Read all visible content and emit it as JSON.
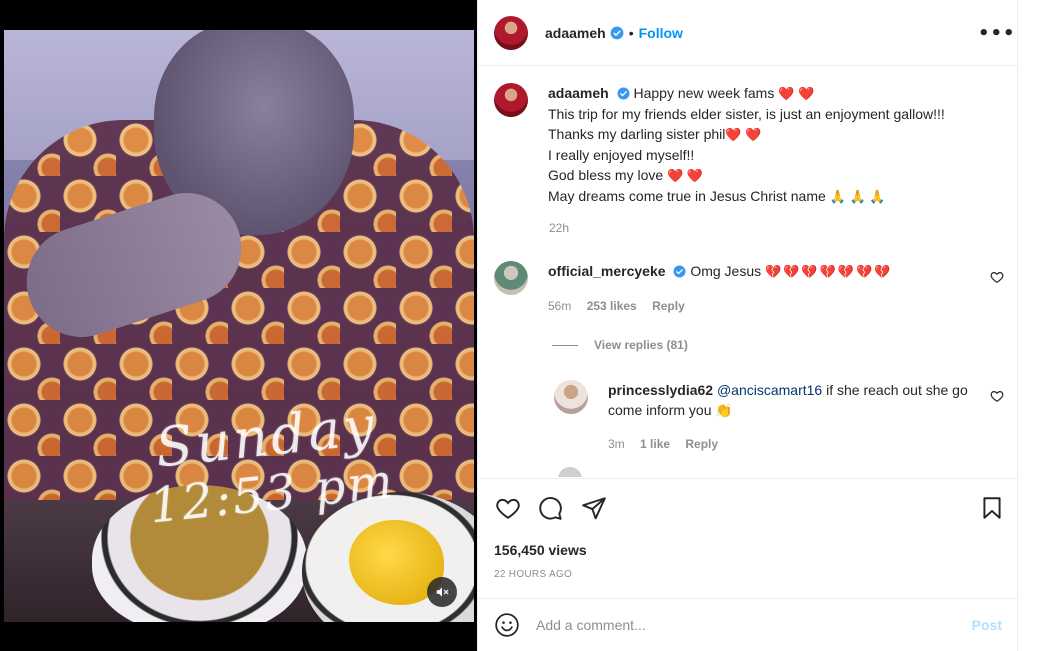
{
  "media": {
    "overlay_day": "Sunday",
    "overlay_time": "12:53 pm",
    "mute_icon": "muted-speaker-icon"
  },
  "post": {
    "author": "adaameh",
    "follow_label": "Follow",
    "separator": "•",
    "more_label": "•••",
    "caption": {
      "line1": "Happy new week fams",
      "line1_emoji": "❤️ ❤️",
      "line2": "This trip for my friends elder sister, is just an enjoyment gallow!!!",
      "line3": "Thanks my darling sister phil",
      "line3_emoji": "❤️ ❤️",
      "line4": "I really enjoyed myself!!",
      "line5": "God bless my love",
      "line5_emoji": "❤️ ❤️",
      "line6": "May dreams come true in Jesus Christ name",
      "line6_emoji": "🙏 🙏 🙏"
    },
    "age": "22h"
  },
  "comments": [
    {
      "user": "official_mercyeke",
      "verified": true,
      "text": "Omg Jesus",
      "emoji": "💔💔💔💔💔💔💔",
      "age": "56m",
      "likes": "253 likes",
      "reply_label": "Reply"
    }
  ],
  "view_replies": "View replies (81)",
  "replies": [
    {
      "user": "princesslydia62",
      "mention": "@anciscamart16",
      "text": " if she reach out she go come inform you",
      "emoji": "👏",
      "age": "3m",
      "likes": "1 like",
      "reply_label": "Reply"
    }
  ],
  "actions": {
    "views": "156,450 views",
    "posted": "22 HOURS AGO"
  },
  "add_comment": {
    "placeholder": "Add a comment...",
    "post_label": "Post"
  },
  "colors": {
    "link": "#0095f6",
    "post_disabled": "#b2dffc",
    "heart": "#e0201a",
    "muted_text": "#8e8e8e"
  }
}
